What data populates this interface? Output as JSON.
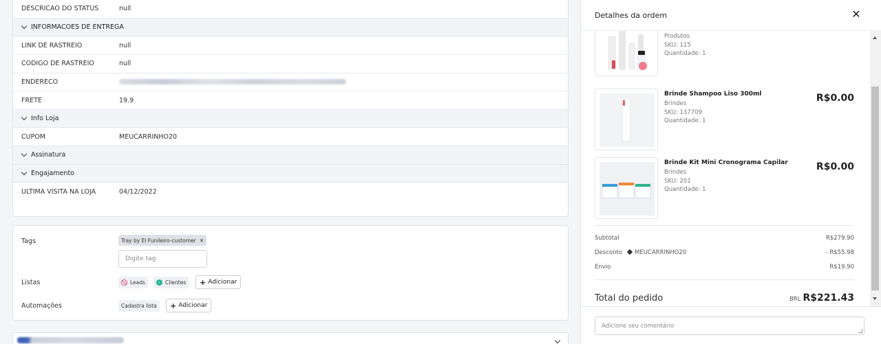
{
  "details": {
    "status_desc": {
      "key": "DESCRICAO DO STATUS",
      "value": "null"
    },
    "delivery_section": "INFORMACOES DE ENTREGA",
    "tracking_link": {
      "key": "LINK DE RASTREIO",
      "value": "null"
    },
    "tracking_code": {
      "key": "CODIGO DE RASTREIO",
      "value": "null"
    },
    "address": {
      "key": "ENDERECO"
    },
    "shipping": {
      "key": "FRETE",
      "value": "19.9"
    },
    "store_section": "Info Loja",
    "coupon": {
      "key": "CUPOM",
      "value": "MEUCARRINHO20"
    },
    "subscription_section": "Assinatura",
    "engagement_section": "Engajamento",
    "last_visit": {
      "key": "ULTIMA VISITA NA LOJA",
      "value": "04/12/2022"
    }
  },
  "tags_card": {
    "tags_label": "Tags",
    "tag": "Tray by El Funileiro-customer",
    "tag_input_placeholder": "Digite tag",
    "lists_label": "Listas",
    "list_leads": "Leads",
    "list_clients": "Clientes",
    "add_label": "Adicionar",
    "automations_label": "Automações",
    "automation": "Cadastra lista"
  },
  "panel": {
    "title": "Detalhes da ordem",
    "items": [
      {
        "name": "",
        "category": "Produtos",
        "sku": "SKU: 115",
        "qty": "Quantidade: 1",
        "price": ""
      },
      {
        "name": "Brinde Shampoo Liso 300ml",
        "category": "Brindes",
        "sku": "SKU: 137709",
        "qty": "Quantidade: 1",
        "price": "R$0.00"
      },
      {
        "name": "Brinde Kit Mini Cronograma Capilar",
        "category": "Brindes",
        "sku": "SKU: 201",
        "qty": "Quantidade: 1",
        "price": "R$0.00"
      }
    ],
    "subtotal_label": "Subtotal",
    "subtotal_value": "R$279.90",
    "discount_label": "Desconto",
    "discount_code": "MEUCARRINHO20",
    "discount_value": "- R$55.98",
    "shipping_label": "Envio",
    "shipping_value": "R$19.90",
    "total_label": "Total do pedido",
    "total_currency": "BRL",
    "total_value": "R$221.43",
    "comment_placeholder": "Adicione seu comentário"
  },
  "colors": {
    "leads": "#e0477a",
    "clients": "#23b594",
    "tag_bg": "#dfe1e6"
  }
}
